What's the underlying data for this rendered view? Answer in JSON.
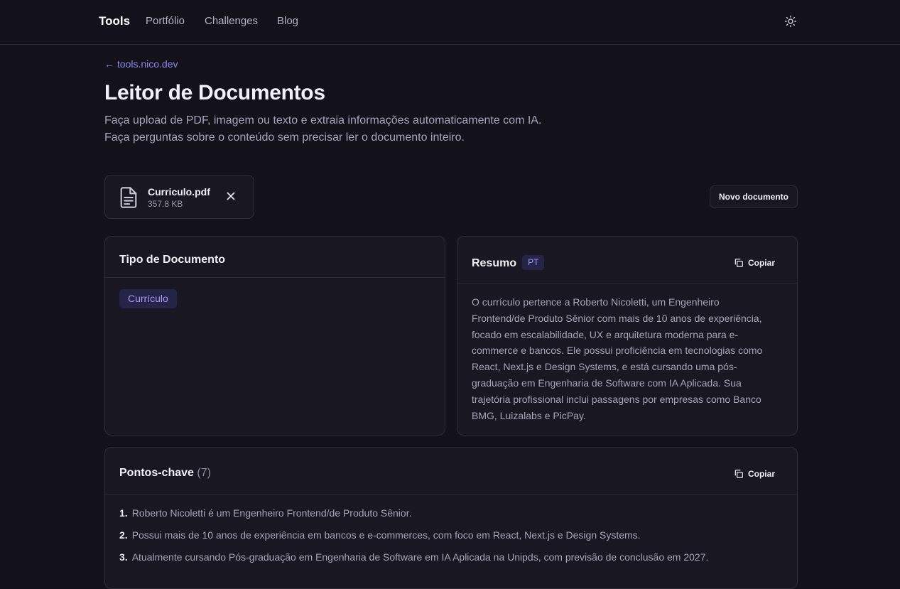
{
  "topbar": {
    "brand": "Tools",
    "nav": [
      "Portfólio",
      "Challenges",
      "Blog"
    ]
  },
  "header": {
    "back_link": "← tools.nico.dev",
    "title": "Leitor de Documentos",
    "subtitle_line1": "Faça upload de PDF, imagem ou texto e extraia informações automaticamente com IA.",
    "subtitle_line2": "Faça perguntas sobre o conteúdo sem precisar ler o documento inteiro."
  },
  "file": {
    "name": "Curriculo.pdf",
    "size": "357.8 KB"
  },
  "actions": {
    "new_document": "Novo documento"
  },
  "doc_type": {
    "title": "Tipo de Documento",
    "value": "Currículo"
  },
  "summary": {
    "title": "Resumo",
    "lang": "PT",
    "copy_label": "Copiar",
    "lines": [
      "O currículo pertence a Roberto Nicoletti, um Engenheiro",
      "Frontend/de Produto Sênior com mais de 10 anos de experiência,",
      "focado em escalabilidade, UX e arquitetura moderna para e-",
      "commerce e bancos. Ele possui proficiência em tecnologias como",
      "React, Next.js e Design Systems, e está cursando uma pós-",
      "graduação em Engenharia de Software com IA Aplicada. Sua",
      "trajetória profissional inclui passagens por empresas como Banco",
      "BMG, Luizalabs e PicPay."
    ]
  },
  "key_points": {
    "title": "Pontos-chave",
    "count": "(7)",
    "copy_label": "Copiar",
    "items": [
      {
        "num": "1.",
        "text": "Roberto Nicoletti é um Engenheiro Frontend/de Produto Sênior."
      },
      {
        "num": "2.",
        "text": "Possui mais de 10 anos de experiência em bancos e e-commerces, com foco em React, Next.js e Design Systems."
      },
      {
        "num": "3.",
        "text": "Atualmente cursando Pós-graduação em Engenharia de Software em IA Aplicada na Unipds, com previsão de conclusão em 2027."
      }
    ]
  },
  "colors": {
    "background": "#13121a",
    "card": "#181722",
    "border": "#2e2d39",
    "accent": "#8b86f0",
    "tag_bg": "#262446"
  },
  "icons": [
    "sun-icon",
    "file-text-icon",
    "close-icon",
    "copy-icon"
  ]
}
